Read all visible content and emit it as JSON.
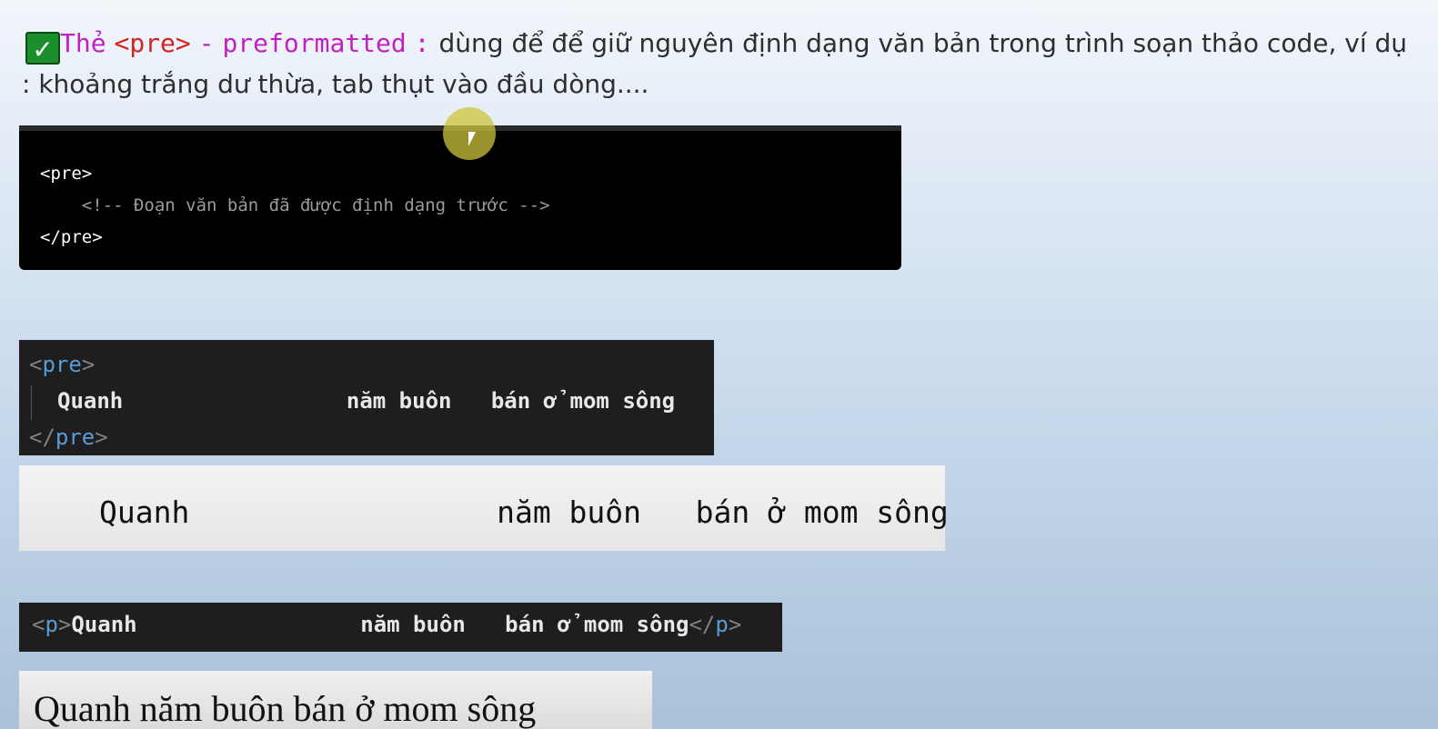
{
  "heading": {
    "check_icon": "checkmark-icon",
    "tag_label": "Thẻ",
    "tag_code": "<pre>",
    "separator": "-",
    "tag_name": "preformatted",
    "colon": ":",
    "description": "dùng để để giữ nguyên định dạng văn bản trong trình soạn thảo code, ví dụ : khoảng trắng dư thừa, tab thụt vào đầu dòng...."
  },
  "syntax_block": {
    "line1": "<pre>",
    "line2": "    <!-- Đoạn văn bản đã được định dạng trước -->",
    "line3": "</pre>"
  },
  "pre_example": {
    "open_lt": "<",
    "open_tag": "pre",
    "open_gt": ">",
    "content": "Quanh                 năm buôn   bán ở mom sông",
    "close_lt": "</",
    "close_tag": "pre",
    "close_gt": ">"
  },
  "pre_render": {
    "text": "Quanh                 năm buôn   bán ở mom sông"
  },
  "p_example": {
    "open_lt": "<",
    "open_tag": "p",
    "open_gt": ">",
    "content": "Quanh                 năm buôn   bán ở mom sông",
    "close_lt": "</",
    "close_tag": "p",
    "close_gt": ">"
  },
  "p_render": {
    "text": "Quanh năm buôn bán ở mom sông"
  },
  "colors": {
    "pink": "#c21fc2",
    "red": "#d32222",
    "tag_blue": "#569cd6",
    "editor_bg": "#1e1e1e"
  }
}
